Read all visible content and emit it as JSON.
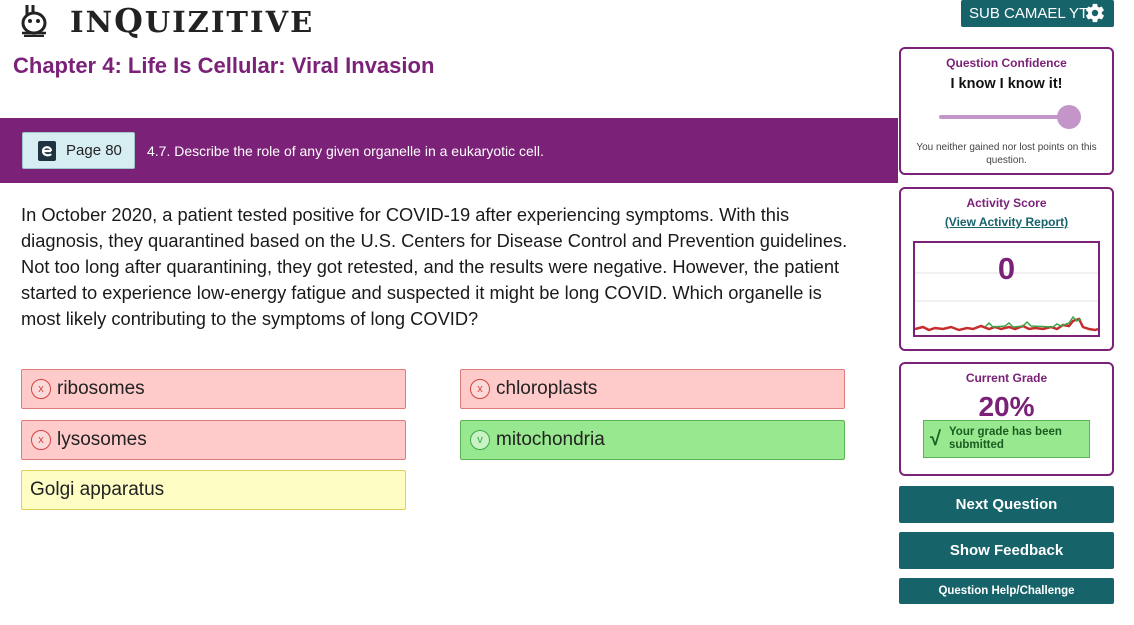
{
  "header": {
    "logo_text_prefix": "IN",
    "logo_text_big": "Q",
    "logo_text_suffix": "UIZITIVE",
    "user_label": "SUB CAMAEL YT",
    "settings_icon": "gear-icon"
  },
  "chapter": {
    "title": "Chapter 4: Life Is Cellular: Viral Invasion"
  },
  "objective_bar": {
    "page_label": "Page 80",
    "objective_text": "4.7. Describe the role of any given organelle in a eukaryotic cell."
  },
  "question": {
    "text": "In October 2020, a patient tested positive for COVID-19 after experiencing symptoms. With this diagnosis, they quarantined based on the U.S. Centers for Disease Control and Prevention guidelines. Not too long after quarantining, they got retested, and the results were negative. However, the patient started to experience low-energy fatigue and suspected it might be long COVID. Which organelle is most likely contributing to the symptoms of long COVID?"
  },
  "answers": [
    {
      "label": "ribosomes",
      "state": "incorrect",
      "mark": "x"
    },
    {
      "label": "chloroplasts",
      "state": "incorrect",
      "mark": "x"
    },
    {
      "label": "lysosomes",
      "state": "incorrect",
      "mark": "x"
    },
    {
      "label": "mitochondria",
      "state": "correct",
      "mark": "v"
    },
    {
      "label": "Golgi apparatus",
      "state": "unselected",
      "mark": ""
    }
  ],
  "confidence": {
    "title": "Question Confidence",
    "value": "I know I know it!",
    "level": 1.0,
    "note": "You neither gained nor lost points on this question."
  },
  "activity": {
    "title": "Activity Score",
    "report_link": "(View Activity Report)",
    "score": "0"
  },
  "grade": {
    "title": "Current Grade",
    "value": "20%",
    "status": "Your grade has been submitted"
  },
  "actions": {
    "next": "Next Question",
    "feedback": "Show Feedback",
    "help": "Question Help/Challenge"
  },
  "colors": {
    "brand_purple": "#7b2278",
    "teal": "#17636a",
    "wrong_bg": "#fecaca",
    "right_bg": "#98e88f",
    "neutral_bg": "#fdfdc4"
  }
}
